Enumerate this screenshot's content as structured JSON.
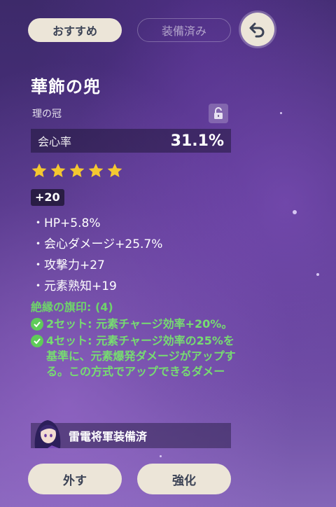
{
  "tabs": {
    "recommended": "おすすめ",
    "equipped": "装備済み"
  },
  "artifact": {
    "name": "華飾の兜",
    "slot": "理の冠",
    "main_stat": {
      "name": "会心率",
      "value": "31.1%"
    },
    "rarity": 5,
    "level": "+20",
    "substats": [
      "・HP+5.8%",
      "・会心ダメージ+25.7%",
      "・攻撃力+27",
      "・元素熟知+19"
    ],
    "set": {
      "name": "絶縁の旗印: (4)",
      "effects": [
        "2セット: 元素チャージ効率+20%。",
        "4セット: 元素チャージ効率の25%を基準に、元素爆発ダメージがアップする。この方式でアップできるダメー"
      ]
    }
  },
  "equipped_by": "雷電将軍装備済",
  "buttons": {
    "remove": "外す",
    "enhance": "強化"
  },
  "icons": {
    "back": "back-arrow-icon",
    "lock": "lock-icon",
    "star": "star-icon",
    "check": "check-icon"
  },
  "colors": {
    "star": "#f4c731",
    "set_green": "#6fd36b",
    "button_bg": "#ece5d8"
  }
}
